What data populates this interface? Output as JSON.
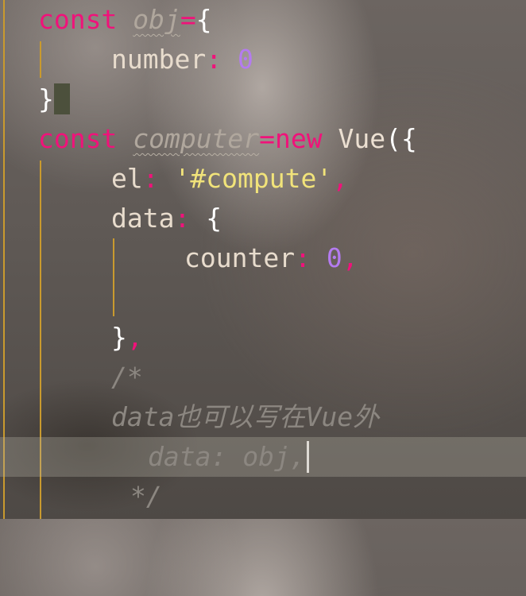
{
  "code": {
    "l1": {
      "kw": "const",
      "id": "obj",
      "op": "=",
      "brace": "{"
    },
    "l2": {
      "prop": "number",
      "colon": ":",
      "num": "0"
    },
    "l3": {
      "brace": "}"
    },
    "l4": {
      "kw": "const",
      "id": "computer",
      "op": "=",
      "new": "new",
      "cls": "Vue",
      "paren": "({"
    },
    "l5": {
      "prop": "el",
      "colon": ":",
      "str": "'#compute'",
      "comma": ","
    },
    "l6": {
      "prop": "data",
      "colon": ":",
      "brace": "{"
    },
    "l7": {
      "prop": "counter",
      "colon": ":",
      "num": "0",
      "comma": ","
    },
    "l9": {
      "brace": "}",
      "comma": ","
    },
    "l10": {
      "comment": "/*"
    },
    "l11": {
      "comment": "data也可以写在Vue外"
    },
    "l12": {
      "comment": "data: obj,"
    },
    "l13": {
      "comment": "*/"
    }
  },
  "colors": {
    "keyword": "#f0127a",
    "string": "#f1e37a",
    "number": "#b47bf0",
    "comment": "#8c8781",
    "indent_guide": "#c99a2e"
  }
}
